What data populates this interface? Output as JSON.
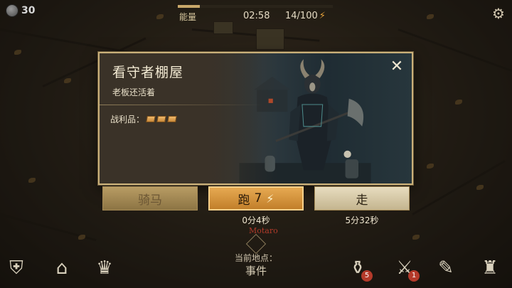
{
  "hud": {
    "coins": "30",
    "energy_label": "能量",
    "timer": "02:58",
    "energy_count": "14/100",
    "energy_progress": 0.14,
    "icons": {
      "coin": "gray-coin-icon",
      "bolt": "lightning-bolt-icon",
      "settings": "gear-icon"
    }
  },
  "modal": {
    "title": "看守者棚屋",
    "subtitle": "老板还活着",
    "loot_label": "战利品：",
    "loot_count": 3,
    "close_icon": "close-icon"
  },
  "actions": {
    "ride": {
      "label": "骑马"
    },
    "run": {
      "label": "跑",
      "cost": "7",
      "duration": "0分4秒"
    },
    "walk": {
      "label": "走",
      "duration": "5分32秒"
    }
  },
  "map": {
    "place_name": "Motaro"
  },
  "location": {
    "label": "当前地点：",
    "value": "事件"
  },
  "bottom_bar": {
    "left_icons": [
      "clan-shields-icon",
      "home-add-icon",
      "crown-icon"
    ],
    "right_icons": [
      {
        "name": "bag-icon",
        "badge": "5"
      },
      {
        "name": "map-axe-icon",
        "badge": "1"
      },
      {
        "name": "scroll-icon",
        "badge": ""
      },
      {
        "name": "character-icon",
        "badge": ""
      }
    ]
  },
  "colors": {
    "accent_gold": "#c9b07a",
    "run_orange": "#e6a952",
    "badge_red": "#b43a2a"
  }
}
